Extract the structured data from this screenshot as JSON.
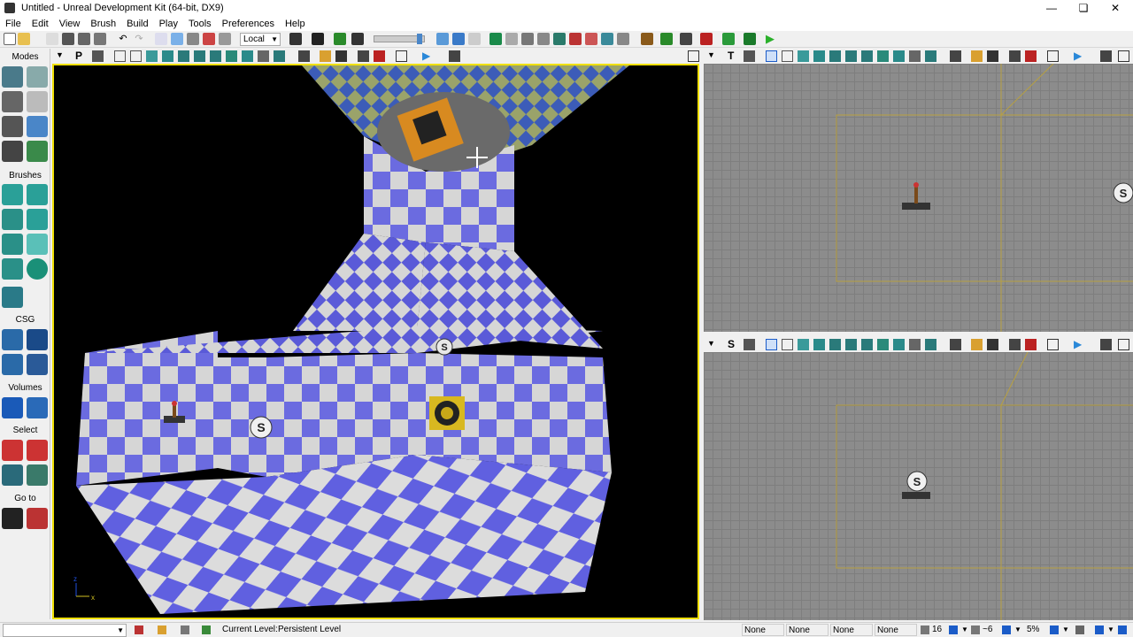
{
  "window": {
    "title": "Untitled - Unreal Development Kit (64-bit, DX9)"
  },
  "menu": [
    "File",
    "Edit",
    "View",
    "Brush",
    "Build",
    "Play",
    "Tools",
    "Preferences",
    "Help"
  ],
  "toolbar": {
    "coord_system": "Local"
  },
  "modes_panel": {
    "header": "Modes",
    "sections": {
      "brushes": "Brushes",
      "csg": "CSG",
      "volumes": "Volumes",
      "select": "Select",
      "goto": "Go to"
    }
  },
  "viewports": {
    "perspective": {
      "mode_letter": "P",
      "axis_x": "x",
      "axis_z": "z"
    },
    "top": {
      "mode_letter": "T"
    },
    "side": {
      "mode_letter": "S"
    }
  },
  "statusbar": {
    "current_level_label": "Current Level:",
    "current_level_value": "Persistent Level",
    "fields": [
      "None",
      "None",
      "None",
      "None"
    ],
    "grid_size": "16",
    "rotation_snap": "~6",
    "scale_snap": "5%"
  },
  "colors": {
    "accent": "#f0e000",
    "selection_blue": "#1b5cc8",
    "grid": "#8c8c8c"
  }
}
